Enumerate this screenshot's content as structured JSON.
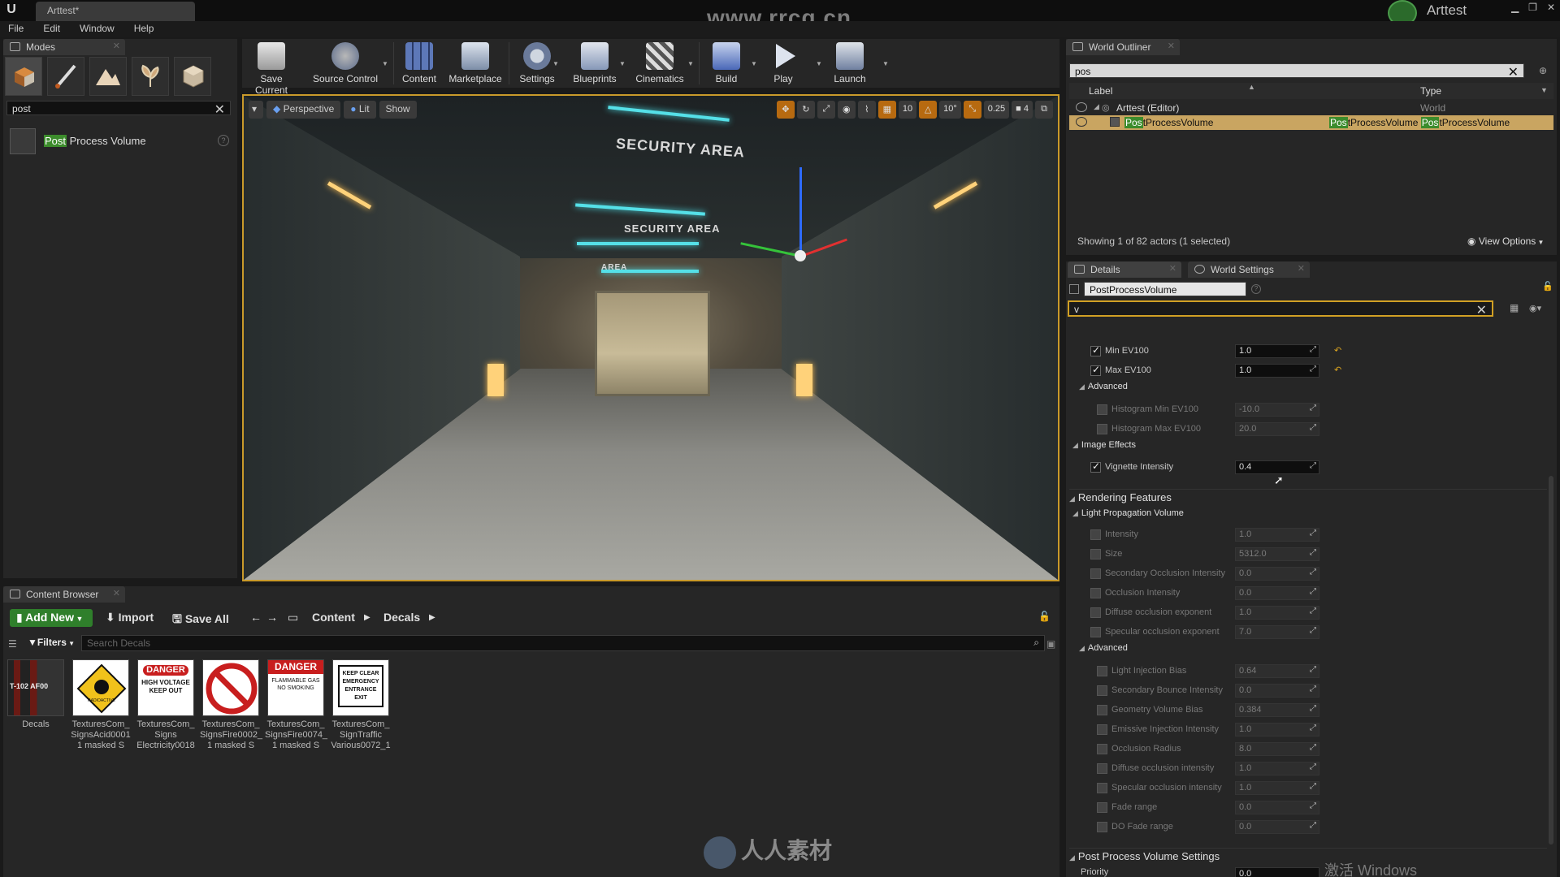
{
  "app": {
    "doc_tab": "Arttest*",
    "watermark_top": "www.rrcg.cn",
    "project_name": "Arttest",
    "menu": [
      "File",
      "Edit",
      "Window",
      "Help"
    ]
  },
  "modes": {
    "tab_label": "Modes",
    "search_value": "post",
    "result_highlight": "Post",
    "result_rest": " Process Volume"
  },
  "toolbar": {
    "buttons": [
      "Save Current",
      "Source Control",
      "Content",
      "Marketplace",
      "Settings",
      "Blueprints",
      "Cinematics",
      "Build",
      "Play",
      "Launch"
    ]
  },
  "viewport": {
    "perspective": "Perspective",
    "lit": "Lit",
    "show": "Show",
    "grid_snap": "10",
    "rot_snap": "10°",
    "scale_snap": "0.25",
    "camera_speed": "4",
    "sign_1": "SECURITY AREA",
    "sign_2": "SECURITY AREA",
    "sign_3": "AREA"
  },
  "content_browser": {
    "tab_label": "Content Browser",
    "add_new": "Add New",
    "import": "Import",
    "save_all": "Save All",
    "crumb_1": "Content",
    "crumb_2": "Decals",
    "filters": "Filters",
    "search_placeholder": "Search Decals",
    "assets": [
      {
        "name": "Decals",
        "line2": "",
        "line3": ""
      },
      {
        "name": "TexturesCom_",
        "line2": "SignsAcid0001",
        "line3": "1 masked S"
      },
      {
        "name": "TexturesCom_",
        "line2": "Signs",
        "line3": "Electricity0018"
      },
      {
        "name": "TexturesCom_",
        "line2": "SignsFire0002_",
        "line3": "1 masked S"
      },
      {
        "name": "TexturesCom_",
        "line2": "SignsFire0074_",
        "line3": "1 masked S"
      },
      {
        "name": "TexturesCom_",
        "line2": "SignTraffic",
        "line3": "Various0072_1"
      }
    ],
    "thumb_texts": {
      "t0": "T-102 AF00",
      "t1": "RADIOACTIVE",
      "t2a": "DANGER",
      "t2b": "HIGH VOLTAGE KEEP OUT",
      "t4a": "DANGER",
      "t4b": "FLAMMABLE GAS NO SMOKING",
      "t5": "KEEP CLEAR EMERGENCY ENTRANCE EXIT"
    }
  },
  "watermark_bottom": "人人素材",
  "outliner": {
    "tab_label": "World Outliner",
    "search_value": "pos",
    "col_label": "Label",
    "col_type": "Type",
    "rows": [
      {
        "label": "Arttest (Editor)",
        "type": "World"
      },
      {
        "label_hl": "Pos",
        "label_rest": "tProcessVolume",
        "type_hl1": "Pos",
        "type_mid": "tProcessVolume",
        "type_hl2": "Pos",
        "type_rest": "tProcessVolume"
      }
    ],
    "status": "Showing 1 of 82 actors (1 selected)",
    "view_options": "View Options"
  },
  "details": {
    "tab_details": "Details",
    "tab_world_settings": "World Settings",
    "actor_name": "PostProcessVolume",
    "search_value": "v",
    "rows": [
      {
        "label": "Min EV100",
        "value": "1.0"
      },
      {
        "label": "Max EV100",
        "value": "1.0"
      },
      {
        "label": "Advanced",
        "value": ""
      },
      {
        "label": "Histogram Min EV100",
        "value": "-10.0"
      },
      {
        "label": "Histogram Max EV100",
        "value": "20.0"
      },
      {
        "label": "Image Effects",
        "value": ""
      },
      {
        "label": "Vignette Intensity",
        "value": "0.4"
      },
      {
        "label": "Rendering Features",
        "value": ""
      },
      {
        "label": "Light Propagation Volume",
        "value": ""
      },
      {
        "label": "Intensity",
        "value": "1.0"
      },
      {
        "label": "Size",
        "value": "5312.0"
      },
      {
        "label": "Secondary Occlusion Intensity",
        "value": "0.0"
      },
      {
        "label": "Occlusion Intensity",
        "value": "0.0"
      },
      {
        "label": "Diffuse occlusion exponent",
        "value": "1.0"
      },
      {
        "label": "Specular occlusion exponent",
        "value": "7.0"
      },
      {
        "label": "Advanced",
        "value": ""
      },
      {
        "label": "Light Injection Bias",
        "value": "0.64"
      },
      {
        "label": "Secondary Bounce Intensity",
        "value": "0.0"
      },
      {
        "label": "Geometry Volume Bias",
        "value": "0.384"
      },
      {
        "label": "Emissive Injection Intensity",
        "value": "1.0"
      },
      {
        "label": "Occlusion Radius",
        "value": "8.0"
      },
      {
        "label": "Diffuse occlusion intensity",
        "value": "1.0"
      },
      {
        "label": "Specular occlusion intensity",
        "value": "1.0"
      },
      {
        "label": "Fade range",
        "value": "0.0"
      },
      {
        "label": "DO Fade range",
        "value": "0.0"
      },
      {
        "label": "Post Process Volume Settings",
        "value": ""
      },
      {
        "label": "Priority",
        "value": "0.0"
      }
    ]
  },
  "os_watermark": "激活 Windows",
  "colors": {
    "accent_orange": "#c99a2a",
    "highlight_green": "#3c8c2c",
    "selection_row": "#c9a561",
    "add_new_green": "#2f7f2b"
  }
}
